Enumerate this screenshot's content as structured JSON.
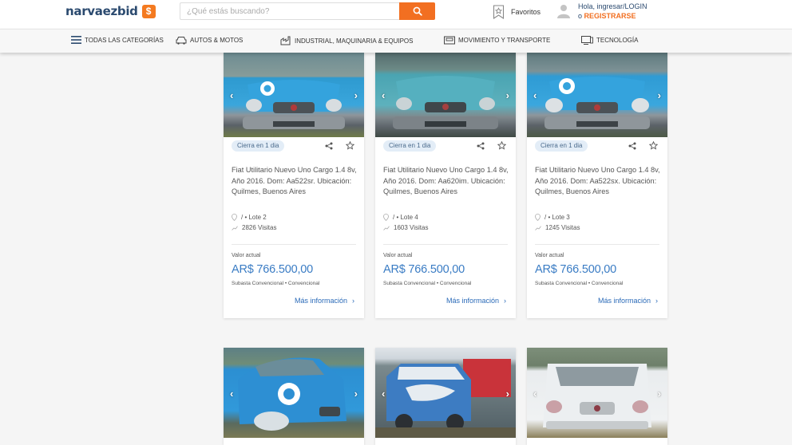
{
  "header": {
    "logo_text": "narvaezbid",
    "logo_badge": "$",
    "search": {
      "placeholder": "¿Qué estás buscando?"
    },
    "favorites_label": "Favoritos",
    "user_greeting": "Hola, ingresar/LOGIN",
    "user_register_prefix": "o ",
    "user_register": "REGISTRARSE",
    "accent_color": "#f26f21",
    "brand_color": "#2b4a6f"
  },
  "categories": [
    {
      "label": "TODAS LAS CATEGORÍAS",
      "icon": "menu-icon"
    },
    {
      "label": "AUTOS & MOTOS",
      "icon": "car-icon"
    },
    {
      "label": "INDUSTRIAL, MAQUINARIA & EQUIPOS",
      "icon": "industry-icon"
    },
    {
      "label": "MOVIMIENTO Y TRANSPORTE",
      "icon": "truck-icon"
    },
    {
      "label": "TECNOLOGÍA",
      "icon": "monitor-icon"
    }
  ],
  "cards": [
    {
      "badge": "Cierra en 1 dia",
      "title": "Fiat Utilitario Nuevo Uno Cargo 1.4 8v, Año 2016. Dom: Aa522sr. Ubicación: Quilmes, Buenos Aires",
      "lot": "/ • Lote 2",
      "visits": "2826 Visitas",
      "value_label": "Valor actual",
      "price": "AR$ 766.500,00",
      "sale_type": "Subasta Convencional • Convencional",
      "more": "Más información"
    },
    {
      "badge": "Cierra en 1 dia",
      "title": "Fiat Utilitario Nuevo Uno Cargo 1.4 8v, Año 2016. Dom: Aa620im. Ubicación: Quilmes, Buenos Aires",
      "lot": "/ • Lote 4",
      "visits": "1603 Visitas",
      "value_label": "Valor actual",
      "price": "AR$ 766.500,00",
      "sale_type": "Subasta Convencional • Convencional",
      "more": "Más información"
    },
    {
      "badge": "Cierra en 1 dia",
      "title": "Fiat Utilitario Nuevo Uno Cargo 1.4 8v, Año 2016. Dom: Aa522sx. Ubicación: Quilmes, Buenos Aires",
      "lot": "/ • Lote 3",
      "visits": "1245 Visitas",
      "value_label": "Valor actual",
      "price": "AR$ 766.500,00",
      "sale_type": "Subasta Convencional • Convencional",
      "more": "Más información"
    }
  ],
  "lower_cards": [
    {
      "photo": "blue-car-side-photo"
    },
    {
      "photo": "blue-van-photo"
    },
    {
      "photo": "white-van-photo"
    }
  ]
}
